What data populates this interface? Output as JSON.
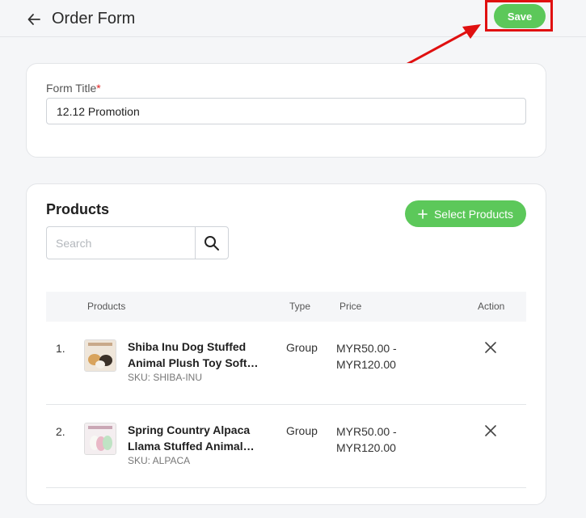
{
  "header": {
    "title": "Order Form",
    "save_label": "Save"
  },
  "form": {
    "title_label": "Form Title",
    "required_mark": "*",
    "title_value": "12.12 Promotion"
  },
  "products": {
    "heading": "Products",
    "select_label": "Select Products",
    "search_placeholder": "Search",
    "columns": {
      "products": "Products",
      "type": "Type",
      "price": "Price",
      "action": "Action"
    },
    "rows": [
      {
        "num": "1.",
        "name_line1": "Shiba Inu Dog Stuffed",
        "name_line2": "Animal Plush Toy Soft…",
        "sku": "SKU: SHIBA-INU",
        "type": "Group",
        "price_line1": "MYR50.00 -",
        "price_line2": "MYR120.00"
      },
      {
        "num": "2.",
        "name_line1": "Spring Country Alpaca",
        "name_line2": "Llama Stuffed Animal…",
        "sku": "SKU: ALPACA",
        "type": "Group",
        "price_line1": "MYR50.00 -",
        "price_line2": "MYR120.00"
      }
    ]
  },
  "colors": {
    "accent_green": "#5cc85a",
    "highlight_red": "#e01010"
  },
  "icons": [
    "arrow-left-icon",
    "plus-icon",
    "search-icon",
    "close-icon"
  ]
}
